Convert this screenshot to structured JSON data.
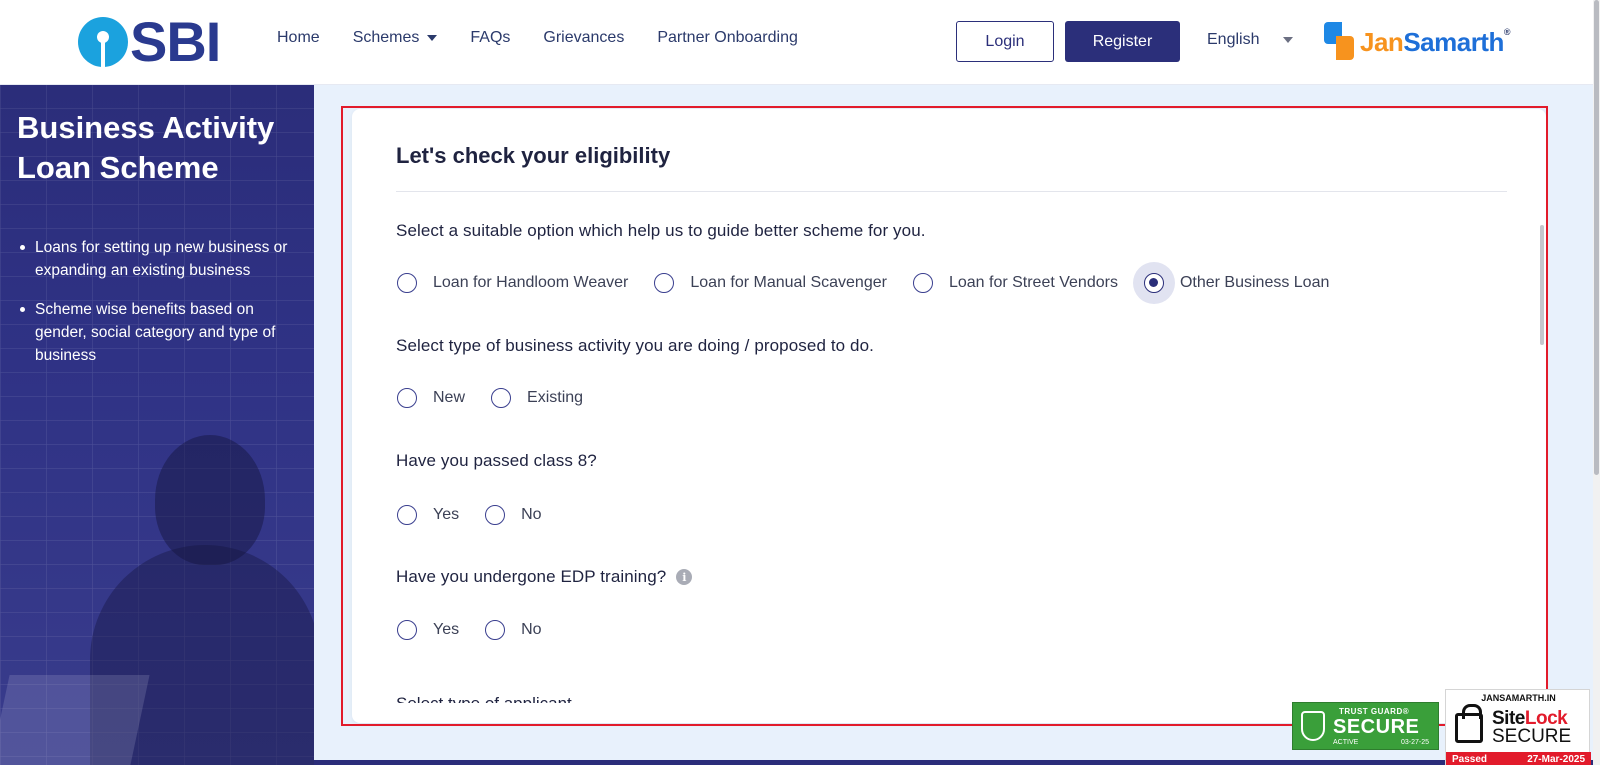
{
  "header": {
    "logo_text": "SBI",
    "nav": [
      {
        "label": "Home"
      },
      {
        "label": "Schemes",
        "has_dropdown": true
      },
      {
        "label": "FAQs"
      },
      {
        "label": "Grievances"
      },
      {
        "label": "Partner Onboarding"
      }
    ],
    "login_label": "Login",
    "register_label": "Register",
    "language": "English",
    "partner_logo": {
      "part1": "Jan",
      "part2": "Samarth",
      "mark": "®"
    }
  },
  "banner": {
    "title": "Business Activity Loan Scheme",
    "bullets": [
      "Loans for setting up new business or expanding an existing business",
      "Scheme wise benefits based on gender, social category and type of business"
    ]
  },
  "form": {
    "title": "Let's check your eligibility",
    "questions": [
      {
        "label": "Select a suitable option which help us to guide better scheme for you.",
        "options": [
          "Loan for Handloom Weaver",
          "Loan for Manual Scavenger",
          "Loan for Street Vendors",
          "Other Business Loan"
        ],
        "selected": "Other Business Loan"
      },
      {
        "label": "Select type of business activity you are doing / proposed to do.",
        "options": [
          "New",
          "Existing"
        ],
        "selected": null
      },
      {
        "label": "Have you passed class 8?",
        "options": [
          "Yes",
          "No"
        ],
        "selected": null
      },
      {
        "label": "Have you undergone EDP training?",
        "options": [
          "Yes",
          "No"
        ],
        "selected": null,
        "info_icon": "info-icon"
      }
    ],
    "next_question_partial": "Select type of applicant"
  },
  "badges": {
    "trust_guard": {
      "line1": "TRUST GUARD®",
      "line2": "SECURE",
      "status": "ACTIVE",
      "date": "03-27-25"
    },
    "sitelock": {
      "site": "JANSAMARTH.IN",
      "brand_a": "Site",
      "brand_b": "Lock",
      "secure": "SECURE",
      "passed": "Passed",
      "date": "27-Mar-2025"
    }
  },
  "colors": {
    "primary": "#2b2f7a",
    "annotation_box": "#e21b2b",
    "background": "#e8f1fc"
  }
}
